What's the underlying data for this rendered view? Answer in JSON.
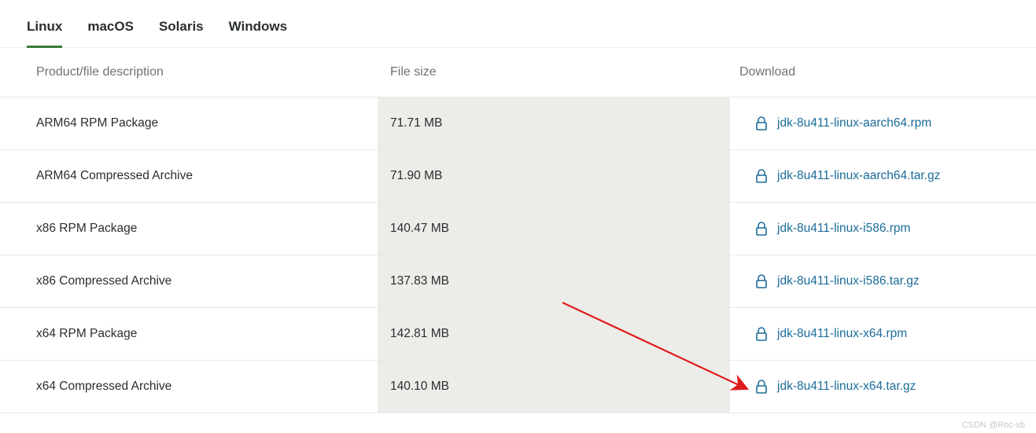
{
  "tabs": [
    {
      "label": "Linux",
      "active": true
    },
    {
      "label": "macOS",
      "active": false
    },
    {
      "label": "Solaris",
      "active": false
    },
    {
      "label": "Windows",
      "active": false
    }
  ],
  "headers": {
    "desc": "Product/file description",
    "size": "File size",
    "download": "Download"
  },
  "rows": [
    {
      "desc": "ARM64 RPM Package",
      "size": "71.71 MB",
      "file": "jdk-8u411-linux-aarch64.rpm"
    },
    {
      "desc": "ARM64 Compressed Archive",
      "size": "71.90 MB",
      "file": "jdk-8u411-linux-aarch64.tar.gz"
    },
    {
      "desc": "x86 RPM Package",
      "size": "140.47 MB",
      "file": "jdk-8u411-linux-i586.rpm"
    },
    {
      "desc": "x86 Compressed Archive",
      "size": "137.83 MB",
      "file": "jdk-8u411-linux-i586.tar.gz"
    },
    {
      "desc": "x64 RPM Package",
      "size": "142.81 MB",
      "file": "jdk-8u411-linux-x64.rpm"
    },
    {
      "desc": "x64 Compressed Archive",
      "size": "140.10 MB",
      "file": "jdk-8u411-linux-x64.tar.gz"
    }
  ],
  "colors": {
    "tab_underline": "#3a7a35",
    "link": "#1b6c99",
    "arrow": "#e01c1c"
  },
  "watermark": "CSDN @Roc-xb"
}
